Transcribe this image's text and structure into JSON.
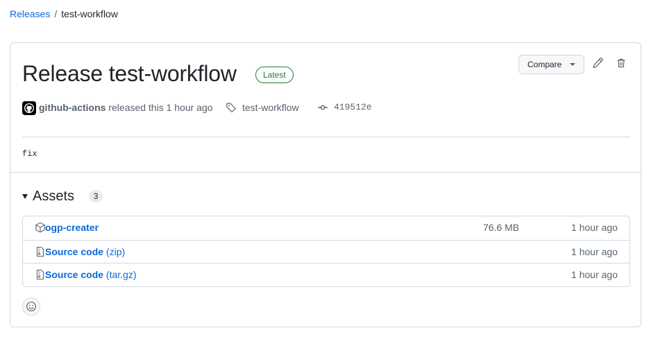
{
  "breadcrumb": {
    "parent": "Releases",
    "separator": "/",
    "current": "test-workflow"
  },
  "release": {
    "title": "Release test-workflow",
    "badge": "Latest",
    "actor": "github-actions",
    "action_text": "released this 1 hour ago",
    "tag": "test-workflow",
    "commit": "419512e",
    "notes": "fix"
  },
  "toolbar": {
    "compare_label": "Compare"
  },
  "assets": {
    "label": "Assets",
    "count": "3",
    "items": [
      {
        "name": "ogp-creater",
        "ext": "",
        "size": "76.6 MB",
        "time": "1 hour ago",
        "icon": "package-icon"
      },
      {
        "name": "Source code",
        "ext": "(zip)",
        "size": "",
        "time": "1 hour ago",
        "icon": "file-zip-icon"
      },
      {
        "name": "Source code",
        "ext": "(tar.gz)",
        "size": "",
        "time": "1 hour ago",
        "icon": "file-zip-icon"
      }
    ]
  },
  "colors": {
    "link": "#0969da",
    "success": "#1a7f37",
    "border": "#d1d9e0",
    "muted": "#59636e"
  }
}
